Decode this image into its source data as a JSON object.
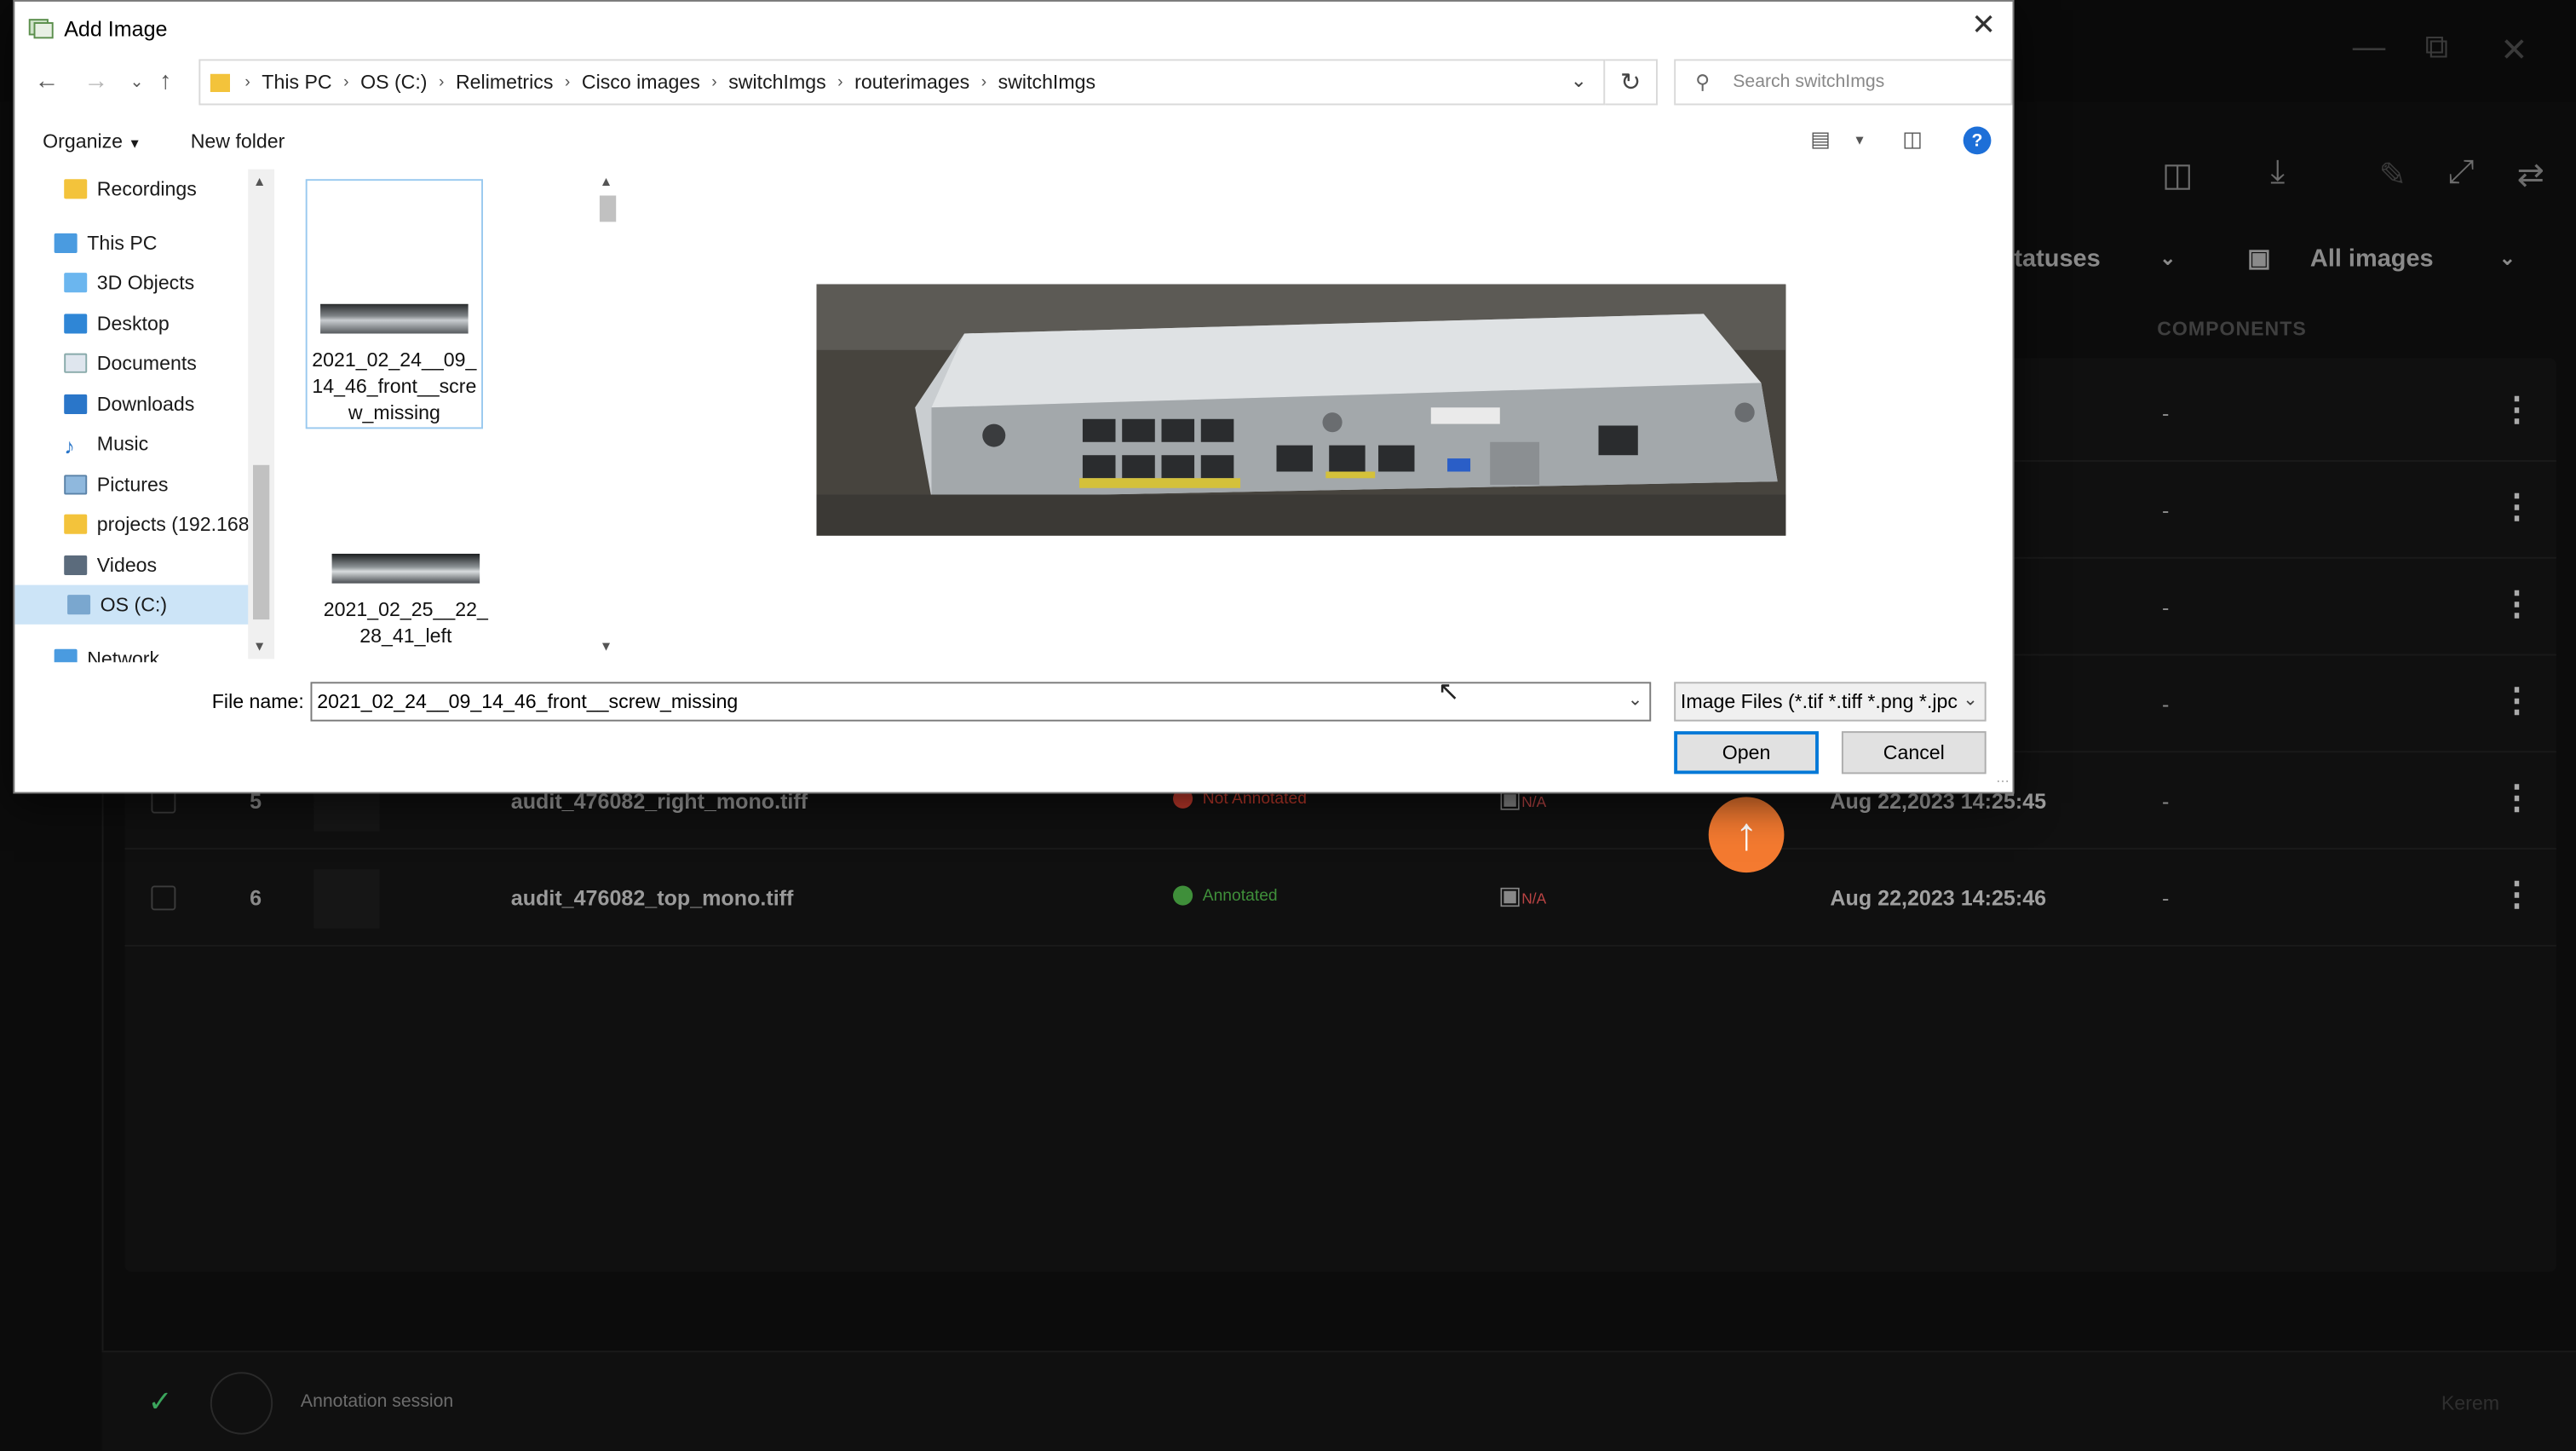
{
  "dialog": {
    "title": "Add Image",
    "breadcrumb": [
      "This PC",
      "OS (C:)",
      "Relimetrics",
      "Cisco images",
      "switchImgs",
      "routerimages",
      "switchImgs"
    ],
    "search_placeholder": "Search switchImgs",
    "organize_label": "Organize",
    "new_folder_label": "New folder",
    "nav_items": [
      "Recordings",
      "This PC",
      "3D Objects",
      "Desktop",
      "Documents",
      "Downloads",
      "Music",
      "Pictures",
      "projects (192.168",
      "Videos",
      "OS (C:)",
      "Network"
    ],
    "files": [
      {
        "name": "2021_02_24__09_14_46_front__screw_missing",
        "lines": [
          "2021_02_24__09_",
          "14_46_front__scre",
          "w_missing"
        ]
      },
      {
        "name": "2021_02_25__22_28_41_left",
        "lines": [
          "2021_02_25__22_",
          "28_41_left"
        ]
      }
    ],
    "file_name_label": "File name:",
    "file_name_value": "2021_02_24__09_14_46_front__screw_missing",
    "file_type": "Image Files (*.tif *.tiff *.png *.jpc",
    "open_label": "Open",
    "cancel_label": "Cancel"
  },
  "background": {
    "filter_statuses": "tatuses",
    "filter_images": "All images",
    "column_components": "COMPONENTS",
    "rows": [
      {
        "num": "",
        "file": "",
        "status": "",
        "date": ":45",
        "components": "-"
      },
      {
        "num": "",
        "file": "",
        "status": "",
        "date": ":45",
        "components": "-"
      },
      {
        "num": "",
        "file": "",
        "status": "",
        "date": ":45",
        "components": "-"
      },
      {
        "num": "",
        "file": "",
        "status": "",
        "date": ":45",
        "components": "-"
      },
      {
        "num": "5",
        "file": "audit_476082_right_mono.tiff",
        "status": "Not Annotated",
        "status_color": "#c0392b",
        "img": "N/A",
        "date": "Aug 22,2023 14:25:45",
        "components": "-"
      },
      {
        "num": "6",
        "file": "audit_476082_top_mono.tiff",
        "status": "Annotated",
        "status_color": "#3f8f3a",
        "img": "N/A",
        "date": "Aug 22,2023 14:25:46",
        "components": "-"
      }
    ],
    "session_label": "Annotation session",
    "user_label": "Kerem"
  },
  "colors": {
    "accent": "#f47a30",
    "primary_button": "#0078d7",
    "help": "#1d6fd8"
  }
}
